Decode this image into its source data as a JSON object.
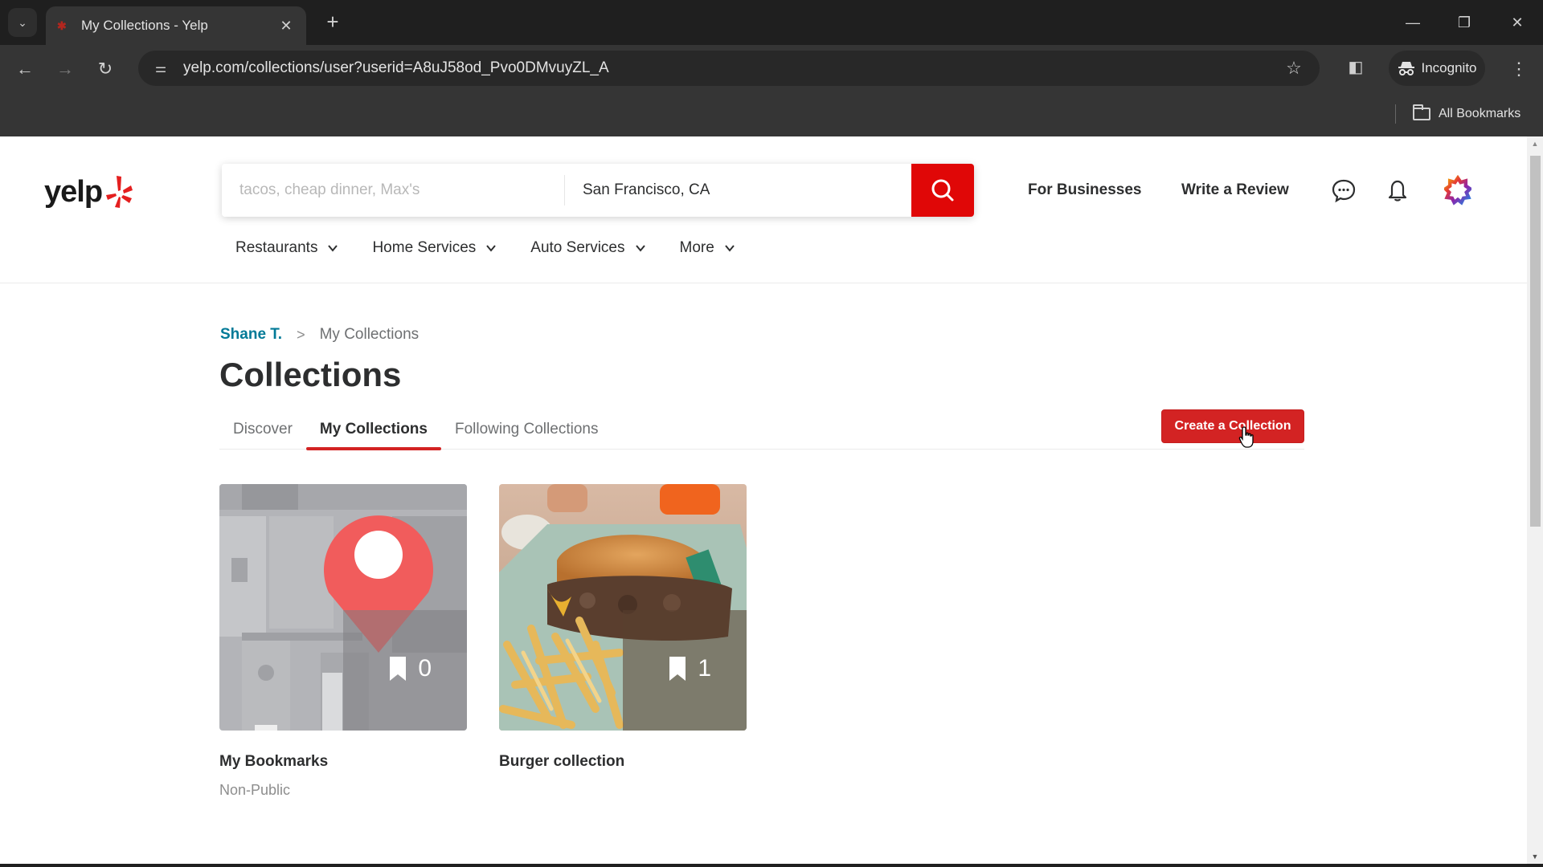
{
  "browser": {
    "tab_title": "My Collections - Yelp",
    "url": "yelp.com/collections/user?userid=A8uJ58od_Pvo0DMvuyZL_A",
    "incognito_label": "Incognito",
    "all_bookmarks_label": "All Bookmarks",
    "icons": {
      "tab_search": "chevron-down-icon",
      "close_tab": "close-icon",
      "new_tab": "plus-icon",
      "back": "arrow-left-icon",
      "forward": "arrow-right-icon",
      "reload": "reload-icon",
      "site_info": "tune-icon",
      "bookmark_star": "star-icon",
      "side_panel": "side-panel-icon",
      "menu": "kebab-icon"
    },
    "glyphs": {
      "tab_search": "⌄",
      "tab_close": "✕",
      "new_tab": "+",
      "back": "←",
      "forward": "→",
      "reload": "↻",
      "site_info": "⚌",
      "star": "☆",
      "side_panel": "◧",
      "incognito": "🕶",
      "kebab": "⋮",
      "minimize": "—",
      "restore": "❐",
      "close_window": "✕"
    }
  },
  "header": {
    "logo_text": "yelp",
    "search": {
      "find_placeholder": "tacos, cheap dinner, Max's",
      "find_value": "",
      "near_value": "San Francisco, CA"
    },
    "links": {
      "for_businesses": "For Businesses",
      "write_review": "Write a Review"
    },
    "categories": [
      {
        "label": "Restaurants"
      },
      {
        "label": "Home Services"
      },
      {
        "label": "Auto Services"
      },
      {
        "label": "More"
      }
    ]
  },
  "breadcrumb": {
    "user": "Shane T.",
    "separator": ">",
    "current": "My Collections"
  },
  "main": {
    "title": "Collections",
    "tabs": [
      {
        "label": "Discover",
        "active": false
      },
      {
        "label": "My Collections",
        "active": true
      },
      {
        "label": "Following Collections",
        "active": false
      }
    ],
    "create_button": "Create a Collection",
    "collections": [
      {
        "title": "My Bookmarks",
        "subtitle": "Non-Public",
        "count": "0",
        "thumbnail": "map-pin-placeholder"
      },
      {
        "title": "Burger collection",
        "subtitle": "",
        "count": "1",
        "thumbnail": "burger-and-fries-photo"
      }
    ]
  },
  "colors": {
    "brand_red": "#d32323",
    "search_red": "#e00707",
    "link_blue": "#027a97",
    "text_dark": "#2d2e2f",
    "text_muted": "#6e7072"
  }
}
